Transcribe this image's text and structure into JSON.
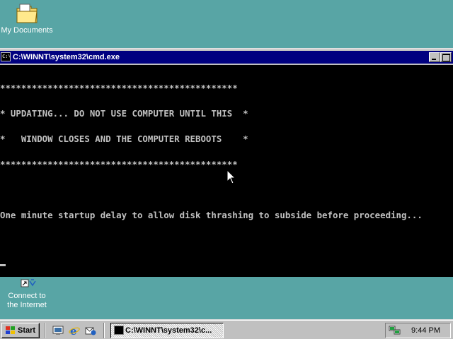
{
  "desktop": {
    "icons": [
      {
        "label": "My Documents",
        "icon": "folder-icon"
      },
      {
        "label_line1": "Connect to",
        "label_line2": "the Internet",
        "icon": "connect-internet-icon"
      }
    ]
  },
  "window": {
    "title": "C:\\WINNT\\system32\\cmd.exe",
    "console_lines": [
      "*********************************************",
      "* UPDATING... DO NOT USE COMPUTER UNTIL THIS  *",
      "*   WINDOW CLOSES AND THE COMPUTER REBOOTS    *",
      "*********************************************",
      "",
      "One minute startup delay to allow disk thrashing to subside before proceeding..."
    ]
  },
  "taskbar": {
    "start_label": "Start",
    "quick_launch": [
      "show-desktop-icon",
      "internet-explorer-icon",
      "outlook-express-icon"
    ],
    "task_label": "C:\\WINNT\\system32\\c...",
    "clock": "9:44 PM"
  },
  "colors": {
    "desktop": "#58a5a5",
    "titlebar": "#000080",
    "console_bg": "#000000",
    "console_text": "#c0c0c0",
    "chrome": "#c0c0c0"
  }
}
